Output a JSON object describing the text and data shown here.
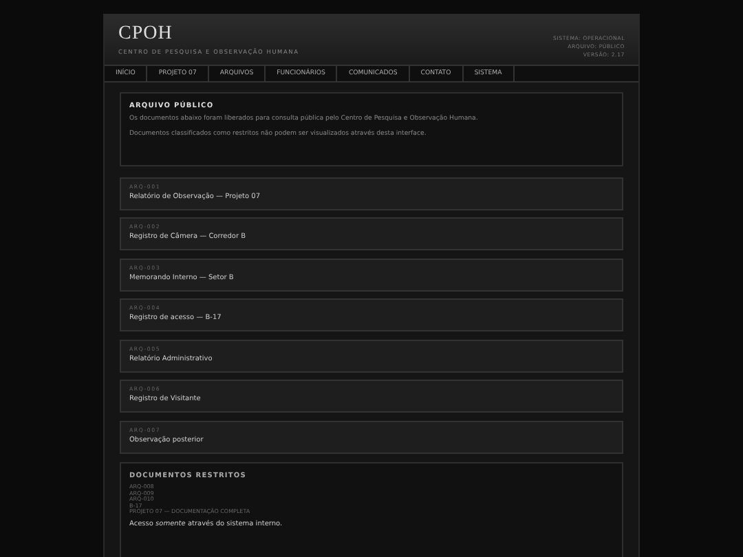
{
  "header": {
    "title": "CPOH",
    "subtitle": "CENTRO DE PESQUISA E OBSERVAÇÃO HUMANA",
    "status_lines": [
      "SISTEMA: OPERACIONAL",
      "ARQUIVO: PÚBLICO",
      "VERSÃO: 2.17"
    ]
  },
  "nav": [
    {
      "label": "INÍCIO",
      "selected": false
    },
    {
      "label": "PROJETO 07",
      "selected": false
    },
    {
      "label": "ARQUIVOS",
      "selected": false
    },
    {
      "label": "FUNCIONÁRIOS",
      "selected": false
    },
    {
      "label": "COMUNICADOS",
      "selected": false
    },
    {
      "label": "CONTATO",
      "selected": false
    },
    {
      "label": "SISTEMA",
      "selected": false
    }
  ],
  "intro": {
    "heading": "ARQUIVO PÚBLICO",
    "paragraphs": [
      "Os documentos abaixo foram liberados para consulta pública pelo Centro de Pesquisa e Observação Humana.",
      "Documentos classificados como restritos não podem ser visualizados através desta interface."
    ]
  },
  "documents": [
    {
      "code": "ARQ-001",
      "title": "Relatório de Observação — Projeto 07"
    },
    {
      "code": "ARQ-002",
      "title": "Registro de Câmera — Corredor B"
    },
    {
      "code": "ARQ-003",
      "title": "Memorando Interno — Setor B"
    },
    {
      "code": "ARQ-004",
      "title": "Registro de acesso — B-17"
    },
    {
      "code": "ARQ-005",
      "title": "Relatório Administrativo"
    },
    {
      "code": "ARQ-006",
      "title": "Registro de Visitante"
    },
    {
      "code": "ARQ-007",
      "title": "Observação posterior"
    }
  ],
  "restricted": {
    "heading": "DOCUMENTOS RESTRITOS",
    "entries": [
      "ARQ-008",
      "ARQ-009",
      "ARQ-010",
      "B-17",
      "PROJETO 07 — DOCUMENTAÇÃO COMPLETA"
    ],
    "note": "Acesso *somente* através do sistema interno."
  }
}
